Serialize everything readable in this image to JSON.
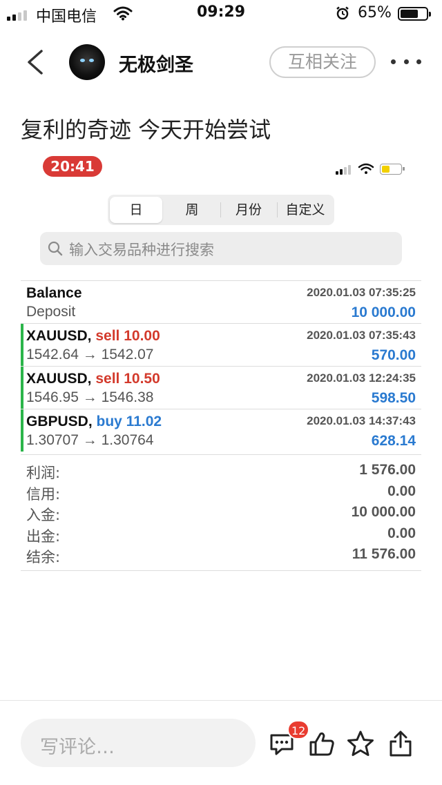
{
  "status_bar": {
    "carrier": "中国电信",
    "time": "09:29",
    "battery_percent": "65%",
    "icons": [
      "signal-icon",
      "wifi-icon",
      "alarm-icon",
      "battery-icon"
    ]
  },
  "nav": {
    "username": "无极剑圣",
    "follow_label": "互相关注",
    "icons": [
      "back-icon",
      "avatar",
      "more-icon"
    ]
  },
  "post": {
    "title": "复利的奇迹 今天开始尝试"
  },
  "screenshot": {
    "time": "20:41",
    "tabs": [
      "日",
      "周",
      "月份",
      "自定义"
    ],
    "active_tab": "日",
    "search_placeholder": "输入交易品种进行搜索",
    "trades": [
      {
        "symbol": "Balance",
        "action": "",
        "action_type": "",
        "date": "2020.01.03 07:35:25",
        "desc": "Deposit",
        "amount": "10 000.00"
      },
      {
        "symbol": "XAUUSD, ",
        "action": "sell 10.00",
        "action_type": "sell",
        "date": "2020.01.03 07:35:43",
        "desc": "1542.64 → 1542.07",
        "amount": "570.00"
      },
      {
        "symbol": "XAUUSD, ",
        "action": "sell 10.50",
        "action_type": "sell",
        "date": "2020.01.03 12:24:35",
        "desc": "1546.95 → 1546.38",
        "amount": "598.50"
      },
      {
        "symbol": "GBPUSD, ",
        "action": "buy 11.02",
        "action_type": "buy",
        "date": "2020.01.03 14:37:43",
        "desc": "1.30707 → 1.30764",
        "amount": "628.14"
      }
    ],
    "summary": [
      {
        "label": "利润:",
        "value": "1 576.00"
      },
      {
        "label": "信用:",
        "value": "0.00"
      },
      {
        "label": "入金:",
        "value": "10 000.00"
      },
      {
        "label": "出金:",
        "value": "0.00"
      },
      {
        "label": "结余:",
        "value": "11 576.00"
      }
    ]
  },
  "bottom_bar": {
    "comment_placeholder": "写评论…",
    "comment_count": "12",
    "icons": [
      "comment-icon",
      "like-icon",
      "star-icon",
      "share-icon"
    ]
  },
  "colors": {
    "sell": "#d33a2c",
    "buy": "#2a7ad0",
    "profit": "#2a7ad0",
    "trade_marker": "#2bb54a",
    "time_pill": "#d93a36",
    "badge": "#e93c30"
  }
}
